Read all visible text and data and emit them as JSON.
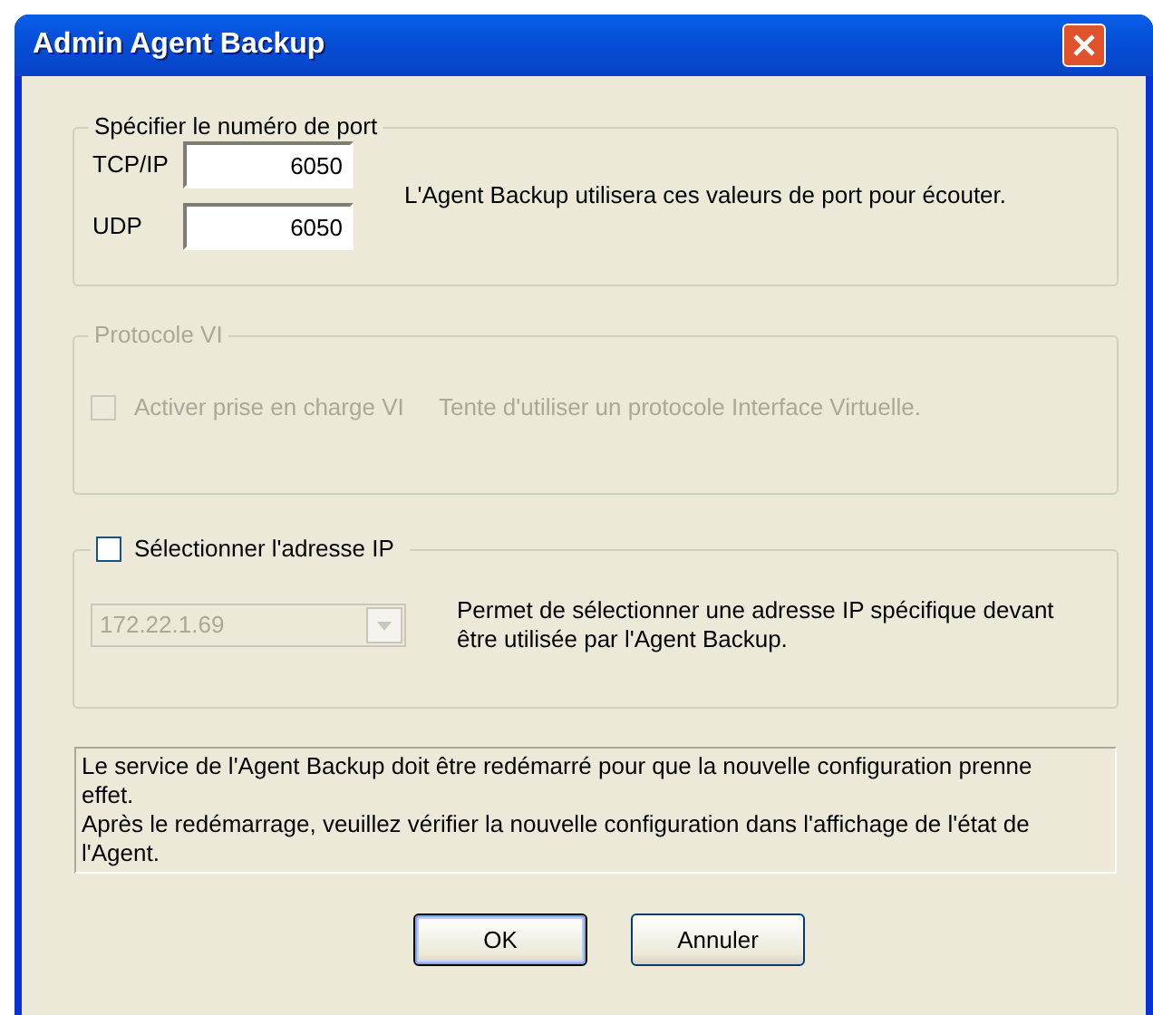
{
  "window": {
    "title": "Admin Agent Backup"
  },
  "port_group": {
    "title": "Spécifier le numéro de port",
    "fields": [
      {
        "label": "TCP/IP",
        "value": "6050"
      },
      {
        "label": "UDP",
        "value": "6050"
      }
    ],
    "description": "L'Agent Backup utilisera ces valeurs de port pour écouter."
  },
  "vi_group": {
    "title": "Protocole VI",
    "disabled": true,
    "checkbox": {
      "label": "Activer prise en charge VI",
      "checked": false
    },
    "description": "Tente d'utiliser un protocole Interface Virtuelle."
  },
  "ip_group": {
    "checkbox": {
      "label": "Sélectionner l'adresse IP",
      "checked": false
    },
    "dropdown": {
      "value": "172.22.1.69",
      "disabled": true
    },
    "description": "Permet de sélectionner une adresse IP spécifique devant être utilisée par l'Agent Backup."
  },
  "notice": [
    "Le service de l'Agent Backup doit être redémarré pour que la nouvelle configuration prenne effet.",
    "Après le redémarrage, veuillez vérifier la nouvelle configuration dans l'affichage de l'état de l'Agent."
  ],
  "buttons": [
    {
      "label": "OK",
      "default": true
    },
    {
      "label": "Annuler",
      "default": false
    }
  ]
}
